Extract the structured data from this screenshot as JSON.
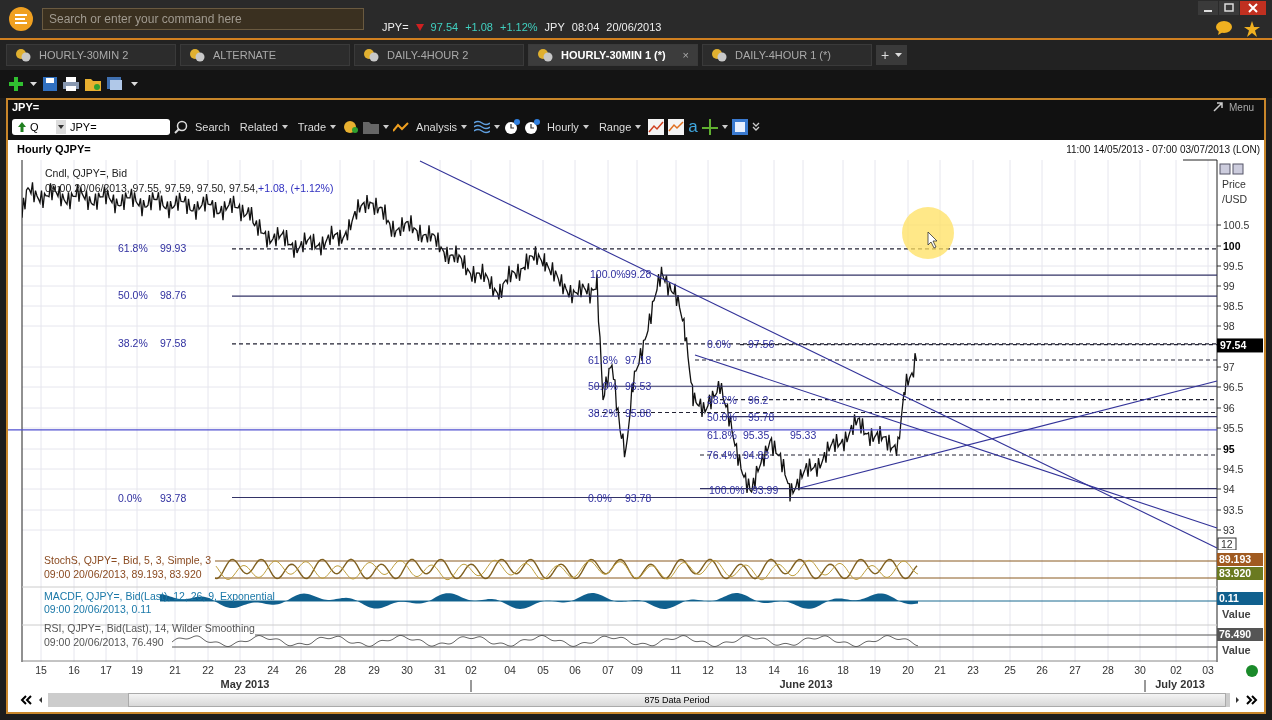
{
  "topbar": {
    "search_placeholder": "Search or enter your command here",
    "ticker": {
      "symbol": "JPY=",
      "last": "97.54",
      "change": "+1.08",
      "change_pct": "+1.12%",
      "currency": "JPY",
      "time": "08:04",
      "date": "20/06/2013"
    }
  },
  "tabs": [
    {
      "label": "HOURLY-30MIN 2",
      "selected": false
    },
    {
      "label": "ALTERNATE",
      "selected": false
    },
    {
      "label": "DAILY-4HOUR 2",
      "selected": false
    },
    {
      "label": "HOURLY-30MIN 1 (*)",
      "selected": true,
      "close": "×"
    },
    {
      "label": "DAILY-4HOUR 1 (*)",
      "selected": false
    }
  ],
  "add_tab": "+",
  "panel": {
    "title": "JPY=",
    "menu": "Menu"
  },
  "chart_toolbar": {
    "ric_prefix": "Q",
    "ric_value": "JPY=",
    "letter": "a",
    "buttons": [
      {
        "label": "Search",
        "caret": false
      },
      {
        "label": "Related",
        "caret": true
      },
      {
        "label": "Trade",
        "caret": true
      },
      {
        "label": "Analysis",
        "caret": true
      },
      {
        "label": "Hourly",
        "caret": true
      },
      {
        "label": "Range",
        "caret": true
      }
    ]
  },
  "chart": {
    "title": "Hourly QJPY=",
    "range": "11:00 14/05/2013 - 07:00 03/07/2013 (LON)",
    "legend": "Cndl, QJPY=, Bid",
    "legend_values": "09:00 20/06/2013, 97.55, 97.59, 97.50, 97.54,",
    "legend_change": "+1.08, (+1.12%)",
    "axis_title": [
      "Price",
      "/USD"
    ],
    "yticks": [
      {
        "label": "100.5",
        "bold": false
      },
      {
        "label": "100",
        "bold": true
      },
      {
        "label": "99.5",
        "bold": false
      },
      {
        "label": "99",
        "bold": false
      },
      {
        "label": "98.5",
        "bold": false
      },
      {
        "label": "98",
        "bold": false
      },
      {
        "label": "97",
        "bold": false
      },
      {
        "label": "96.5",
        "bold": false
      },
      {
        "label": "96",
        "bold": false
      },
      {
        "label": "95.5",
        "bold": false
      },
      {
        "label": "95",
        "bold": true
      },
      {
        "label": "94.5",
        "bold": false
      },
      {
        "label": "94",
        "bold": false
      },
      {
        "label": "93.5",
        "bold": false
      },
      {
        "label": "93",
        "bold": false
      }
    ],
    "last_price": "97.54",
    "scale_box": "12",
    "fib_sets": [
      {
        "labels": [
          {
            "pct": "61.8%",
            "price": "99.93"
          },
          {
            "pct": "50.0%",
            "price": "98.76"
          },
          {
            "pct": "38.2%",
            "price": "97.58"
          },
          {
            "pct": "0.0%",
            "price": "93.78"
          }
        ]
      },
      {
        "labels": [
          {
            "pct": "100.0%",
            "price": "99.28"
          },
          {
            "pct": "61.8%",
            "price": "97.18"
          },
          {
            "pct": "50.0%",
            "price": "96.53"
          },
          {
            "pct": "38.2%",
            "price": "95.88"
          },
          {
            "pct": "0.0%",
            "price": "93.78"
          }
        ]
      },
      {
        "labels": [
          {
            "pct": "0.0%",
            "price": "97.56"
          },
          {
            "pct": "38.2%",
            "price": "96.2"
          },
          {
            "pct": "50.0%",
            "price": "95.78"
          },
          {
            "pct": "61.8%",
            "price": "95.35"
          },
          {
            "pct": "76.4%",
            "price": "94.83"
          },
          {
            "pct": "100.0%",
            "price": "93.99"
          }
        ]
      }
    ],
    "extra_label": "95.33"
  },
  "indicators": [
    {
      "kind": "stoch",
      "title": "StochS, QJPY=, Bid,  5, 3, Simple, 3",
      "values": "09:00 20/06/2013, 89.193, 83.920",
      "readouts": [
        "89.193",
        "83.920"
      ]
    },
    {
      "kind": "macd",
      "title": "MACDF, QJPY=, Bid(Last),  12, 26, 9, Exponential",
      "values": "09:00 20/06/2013, 0.11",
      "readouts": [
        "0.11"
      ],
      "unit": "Value"
    },
    {
      "kind": "rsi",
      "title": "RSI, QJPY=, Bid(Last),  14, Wilder Smoothing",
      "values": "09:00 20/06/2013, 76.490",
      "readouts": [
        "76.490"
      ],
      "unit": "Value"
    }
  ],
  "xaxis": {
    "days": [
      "15",
      "16",
      "17",
      "19",
      "21",
      "22",
      "23",
      "24",
      "26",
      "28",
      "29",
      "30",
      "31",
      "02",
      "04",
      "05",
      "06",
      "07",
      "09",
      "11",
      "12",
      "13",
      "14",
      "16",
      "18",
      "19",
      "20",
      "21",
      "23",
      "25",
      "26",
      "27",
      "28",
      "30",
      "02",
      "03"
    ],
    "months": [
      "May 2013",
      "June 2013",
      "July 2013"
    ]
  },
  "scrollbar": {
    "label": "875 Data Period"
  }
}
